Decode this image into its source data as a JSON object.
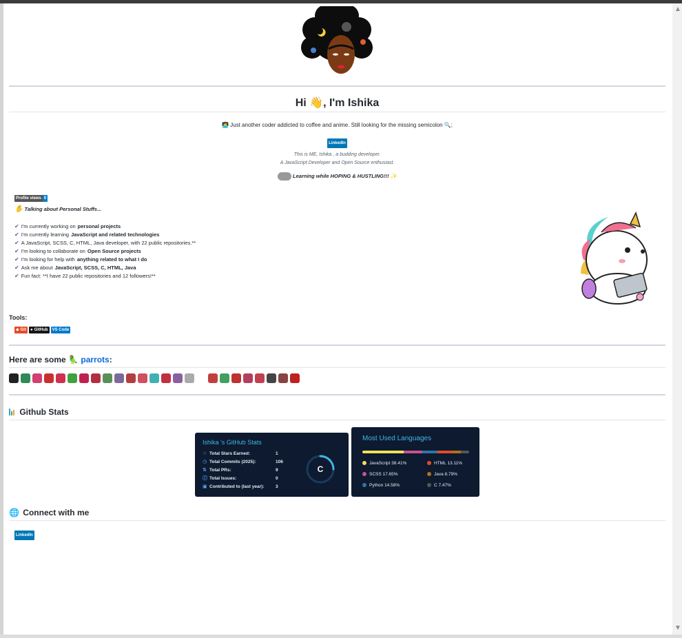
{
  "header": {
    "greeting": "Hi 👋, I'm Ishika",
    "subtitle": "👩‍💻 Just another coder addicted to coffee and anime. Still looking for the missing semicolon 🔍;",
    "linkedin_badge": "LinkedIn",
    "intro_line1": "This is ME, Ishika , a budding developer.",
    "intro_line2": "A JavaScript Developer and Open Source enthusiast.",
    "learning": "Learning while HOPING & HUSTLING!!! ",
    "profile_views_label": "Profile views",
    "profile_views_value": "0"
  },
  "personal": {
    "title": "Talking about Personal Stuffs...",
    "items": [
      {
        "prefix": "I'm currently working on ",
        "bold": "personal projects",
        "suffix": ""
      },
      {
        "prefix": "I'm currently learning ",
        "bold": "JavaScript and related technologies",
        "suffix": ""
      },
      {
        "prefix": "A JavaScript, SCSS, C, HTML, Java developer, with 22 public repositories.**",
        "bold": "",
        "suffix": ""
      },
      {
        "prefix": "I'm looking to collaborate on ",
        "bold": "Open Source projects",
        "suffix": ""
      },
      {
        "prefix": "I'm looking for help with ",
        "bold": "anything related to what I do",
        "suffix": ""
      },
      {
        "prefix": "Ask me about ",
        "bold": "JavaScript, SCSS, C, HTML, Java",
        "suffix": ""
      },
      {
        "prefix": "Fun fact: **I have 22 public repositories and 12 followers!**",
        "bold": "",
        "suffix": ""
      }
    ]
  },
  "tools": {
    "label": "Tools:",
    "badges": [
      {
        "label": "Git",
        "color": "#e34c26"
      },
      {
        "label": "GitHub",
        "color": "#181717"
      },
      {
        "label": "VS Code",
        "color": "#007acc"
      }
    ]
  },
  "parrots": {
    "prefix": "Here are some ",
    "link": "parrots",
    "suffix": ":",
    "colors": [
      "#222",
      "#2e8b57",
      "#d04070",
      "#c83030",
      "#d03050",
      "#40a040",
      "#c02050",
      "#b03040",
      "#5a8f5a",
      "#7a6a9a",
      "#b04040",
      "#d05060",
      "#40b0b0",
      "#c03040",
      "#8a60a0",
      "#aaa",
      "#ffffff",
      "#c04040",
      "#40a060",
      "#c03030",
      "#b04060",
      "#c04050",
      "#444",
      "#884444",
      "#c02020"
    ]
  },
  "github_stats": {
    "title": "Github Stats",
    "card_title": "Ishika 's GitHub Stats",
    "rows": [
      {
        "label": "Total Stars Earned:",
        "value": "1",
        "icon": "☆"
      },
      {
        "label": "Total Commits (2025):",
        "value": "106",
        "icon": "◷"
      },
      {
        "label": "Total PRs:",
        "value": "9",
        "icon": "⇅"
      },
      {
        "label": "Total Issues:",
        "value": "0",
        "icon": "ⓘ"
      },
      {
        "label": "Contributed to (last year):",
        "value": "3",
        "icon": "▣"
      }
    ],
    "grade": "C",
    "grade_progress": 0.25
  },
  "languages": {
    "title": "Most Used Languages",
    "items": [
      {
        "name": "JavaScript",
        "pct": "38.41%",
        "value": 38.41,
        "color": "#f1e05a"
      },
      {
        "name": "HTML",
        "pct": "13.11%",
        "value": 13.11,
        "color": "#e34c26"
      },
      {
        "name": "SCSS",
        "pct": "17.65%",
        "value": 17.65,
        "color": "#c6538c"
      },
      {
        "name": "Java",
        "pct": "8.79%",
        "value": 8.79,
        "color": "#b07219"
      },
      {
        "name": "Python",
        "pct": "14.58%",
        "value": 14.58,
        "color": "#3572a5"
      },
      {
        "name": "C",
        "pct": "7.47%",
        "value": 7.47,
        "color": "#555555"
      }
    ]
  },
  "connect": {
    "title": "Connect with me",
    "linkedin": "LinkedIn"
  }
}
